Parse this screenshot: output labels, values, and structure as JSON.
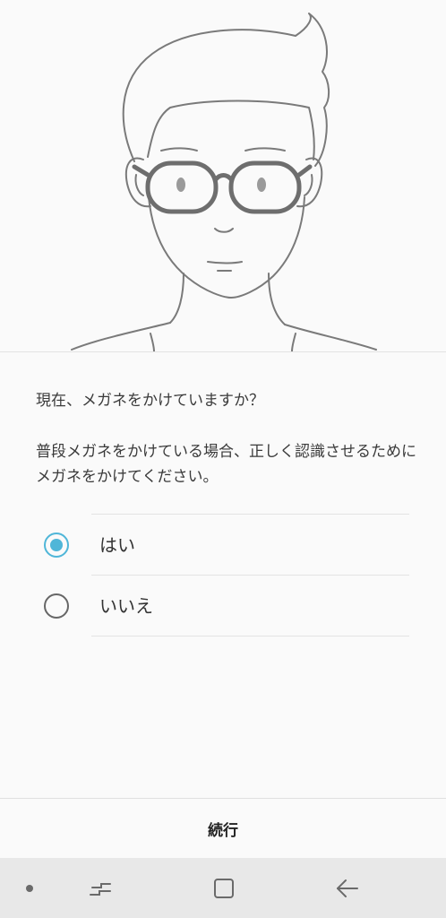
{
  "illustration": {
    "description_icon": "face-with-glasses-illustration",
    "line_color": "#7a7a7a",
    "glasses_color": "#6e6e6e"
  },
  "question": "現在、メガネをかけていますか？",
  "description": "普段メガネをかけている場合、正しく認識させるためにメガネをかけてください。",
  "options": [
    {
      "label": "はい",
      "selected": true
    },
    {
      "label": "いいえ",
      "selected": false
    }
  ],
  "accent_color": "#4fb6d8",
  "continue_label": "続行",
  "navbar": {
    "items": [
      "dot-icon",
      "recent-apps-icon",
      "home-icon",
      "back-icon"
    ]
  }
}
